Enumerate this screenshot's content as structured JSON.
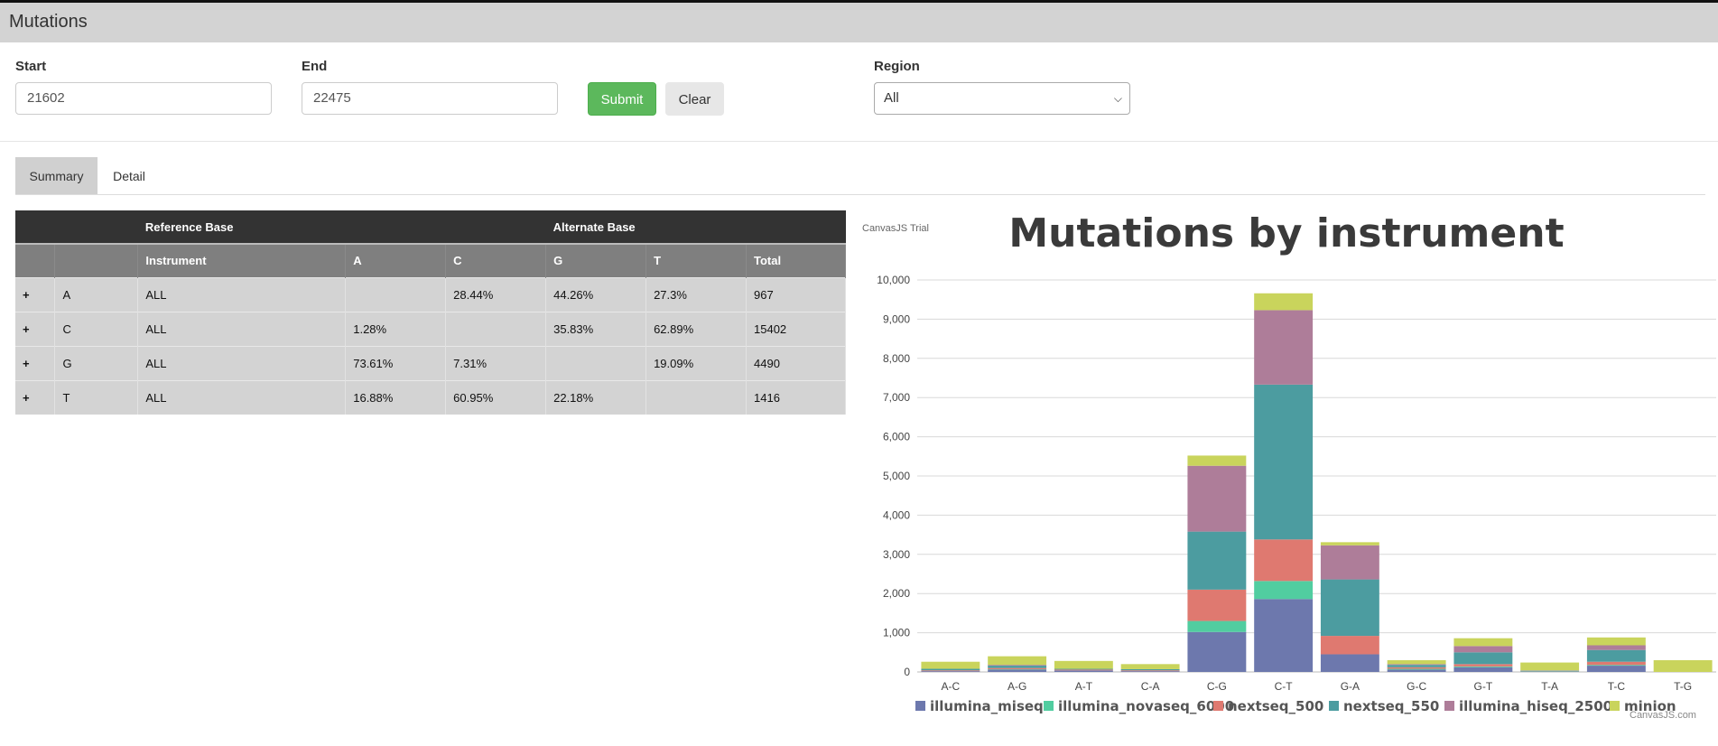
{
  "app": {
    "title": "Mutations"
  },
  "form": {
    "start_label": "Start",
    "start_value": "21602",
    "end_label": "End",
    "end_value": "22475",
    "submit_label": "Submit",
    "clear_label": "Clear",
    "region_label": "Region",
    "region_selected": "All"
  },
  "tabs": [
    {
      "label": "Summary",
      "active": true
    },
    {
      "label": "Detail",
      "active": false
    }
  ],
  "table": {
    "group_headers": {
      "reference": "Reference Base",
      "alternate": "Alternate Base"
    },
    "columns": [
      "",
      "",
      "Instrument",
      "A",
      "C",
      "G",
      "T",
      "Total"
    ],
    "rows": [
      {
        "expand": "+",
        "base": "A",
        "instrument": "ALL",
        "A": "",
        "C": "28.44%",
        "G": "44.26%",
        "T": "27.3%",
        "total": "967"
      },
      {
        "expand": "+",
        "base": "C",
        "instrument": "ALL",
        "A": "1.28%",
        "C": "",
        "G": "35.83%",
        "T": "62.89%",
        "total": "15402"
      },
      {
        "expand": "+",
        "base": "G",
        "instrument": "ALL",
        "A": "73.61%",
        "C": "7.31%",
        "G": "",
        "T": "19.09%",
        "total": "4490"
      },
      {
        "expand": "+",
        "base": "T",
        "instrument": "ALL",
        "A": "16.88%",
        "C": "60.95%",
        "G": "22.18%",
        "T": "",
        "total": "1416"
      }
    ]
  },
  "chart_watermark": "CanvasJS Trial",
  "chart_credit": "CanvasJS.com",
  "chart_data": {
    "type": "bar",
    "stacked": true,
    "title": "Mutations by instrument",
    "xlabel": "",
    "ylabel": "",
    "ylim": [
      0,
      10000
    ],
    "yticks": [
      "0",
      "1,000",
      "2,000",
      "3,000",
      "4,000",
      "5,000",
      "6,000",
      "7,000",
      "8,000",
      "9,000",
      "10,000"
    ],
    "grid": true,
    "legend_position": "bottom",
    "categories": [
      "A-C",
      "A-G",
      "A-T",
      "C-A",
      "C-G",
      "C-T",
      "G-A",
      "G-C",
      "G-T",
      "T-A",
      "T-C",
      "T-G"
    ],
    "series": [
      {
        "name": "illumina_miseq",
        "color": "#6d78ad",
        "values": [
          20,
          60,
          40,
          20,
          1020,
          1860,
          450,
          60,
          120,
          10,
          160,
          0
        ]
      },
      {
        "name": "illumina_novaseq_6000",
        "color": "#51cda0",
        "values": [
          0,
          10,
          0,
          0,
          280,
          460,
          0,
          20,
          20,
          10,
          20,
          0
        ]
      },
      {
        "name": "nextseq_500",
        "color": "#df7970",
        "values": [
          20,
          30,
          20,
          20,
          800,
          1060,
          470,
          40,
          60,
          10,
          80,
          0
        ]
      },
      {
        "name": "nextseq_550",
        "color": "#4c9ca0",
        "values": [
          40,
          60,
          20,
          30,
          1480,
          3950,
          1440,
          60,
          300,
          10,
          300,
          0
        ]
      },
      {
        "name": "illumina_hiseq_2500",
        "color": "#ae7d99",
        "values": [
          0,
          20,
          0,
          0,
          1680,
          1900,
          870,
          20,
          160,
          0,
          120,
          0
        ]
      },
      {
        "name": "minion",
        "color": "#c9d45c",
        "values": [
          180,
          220,
          200,
          130,
          260,
          430,
          80,
          100,
          200,
          200,
          200,
          300
        ]
      }
    ]
  }
}
